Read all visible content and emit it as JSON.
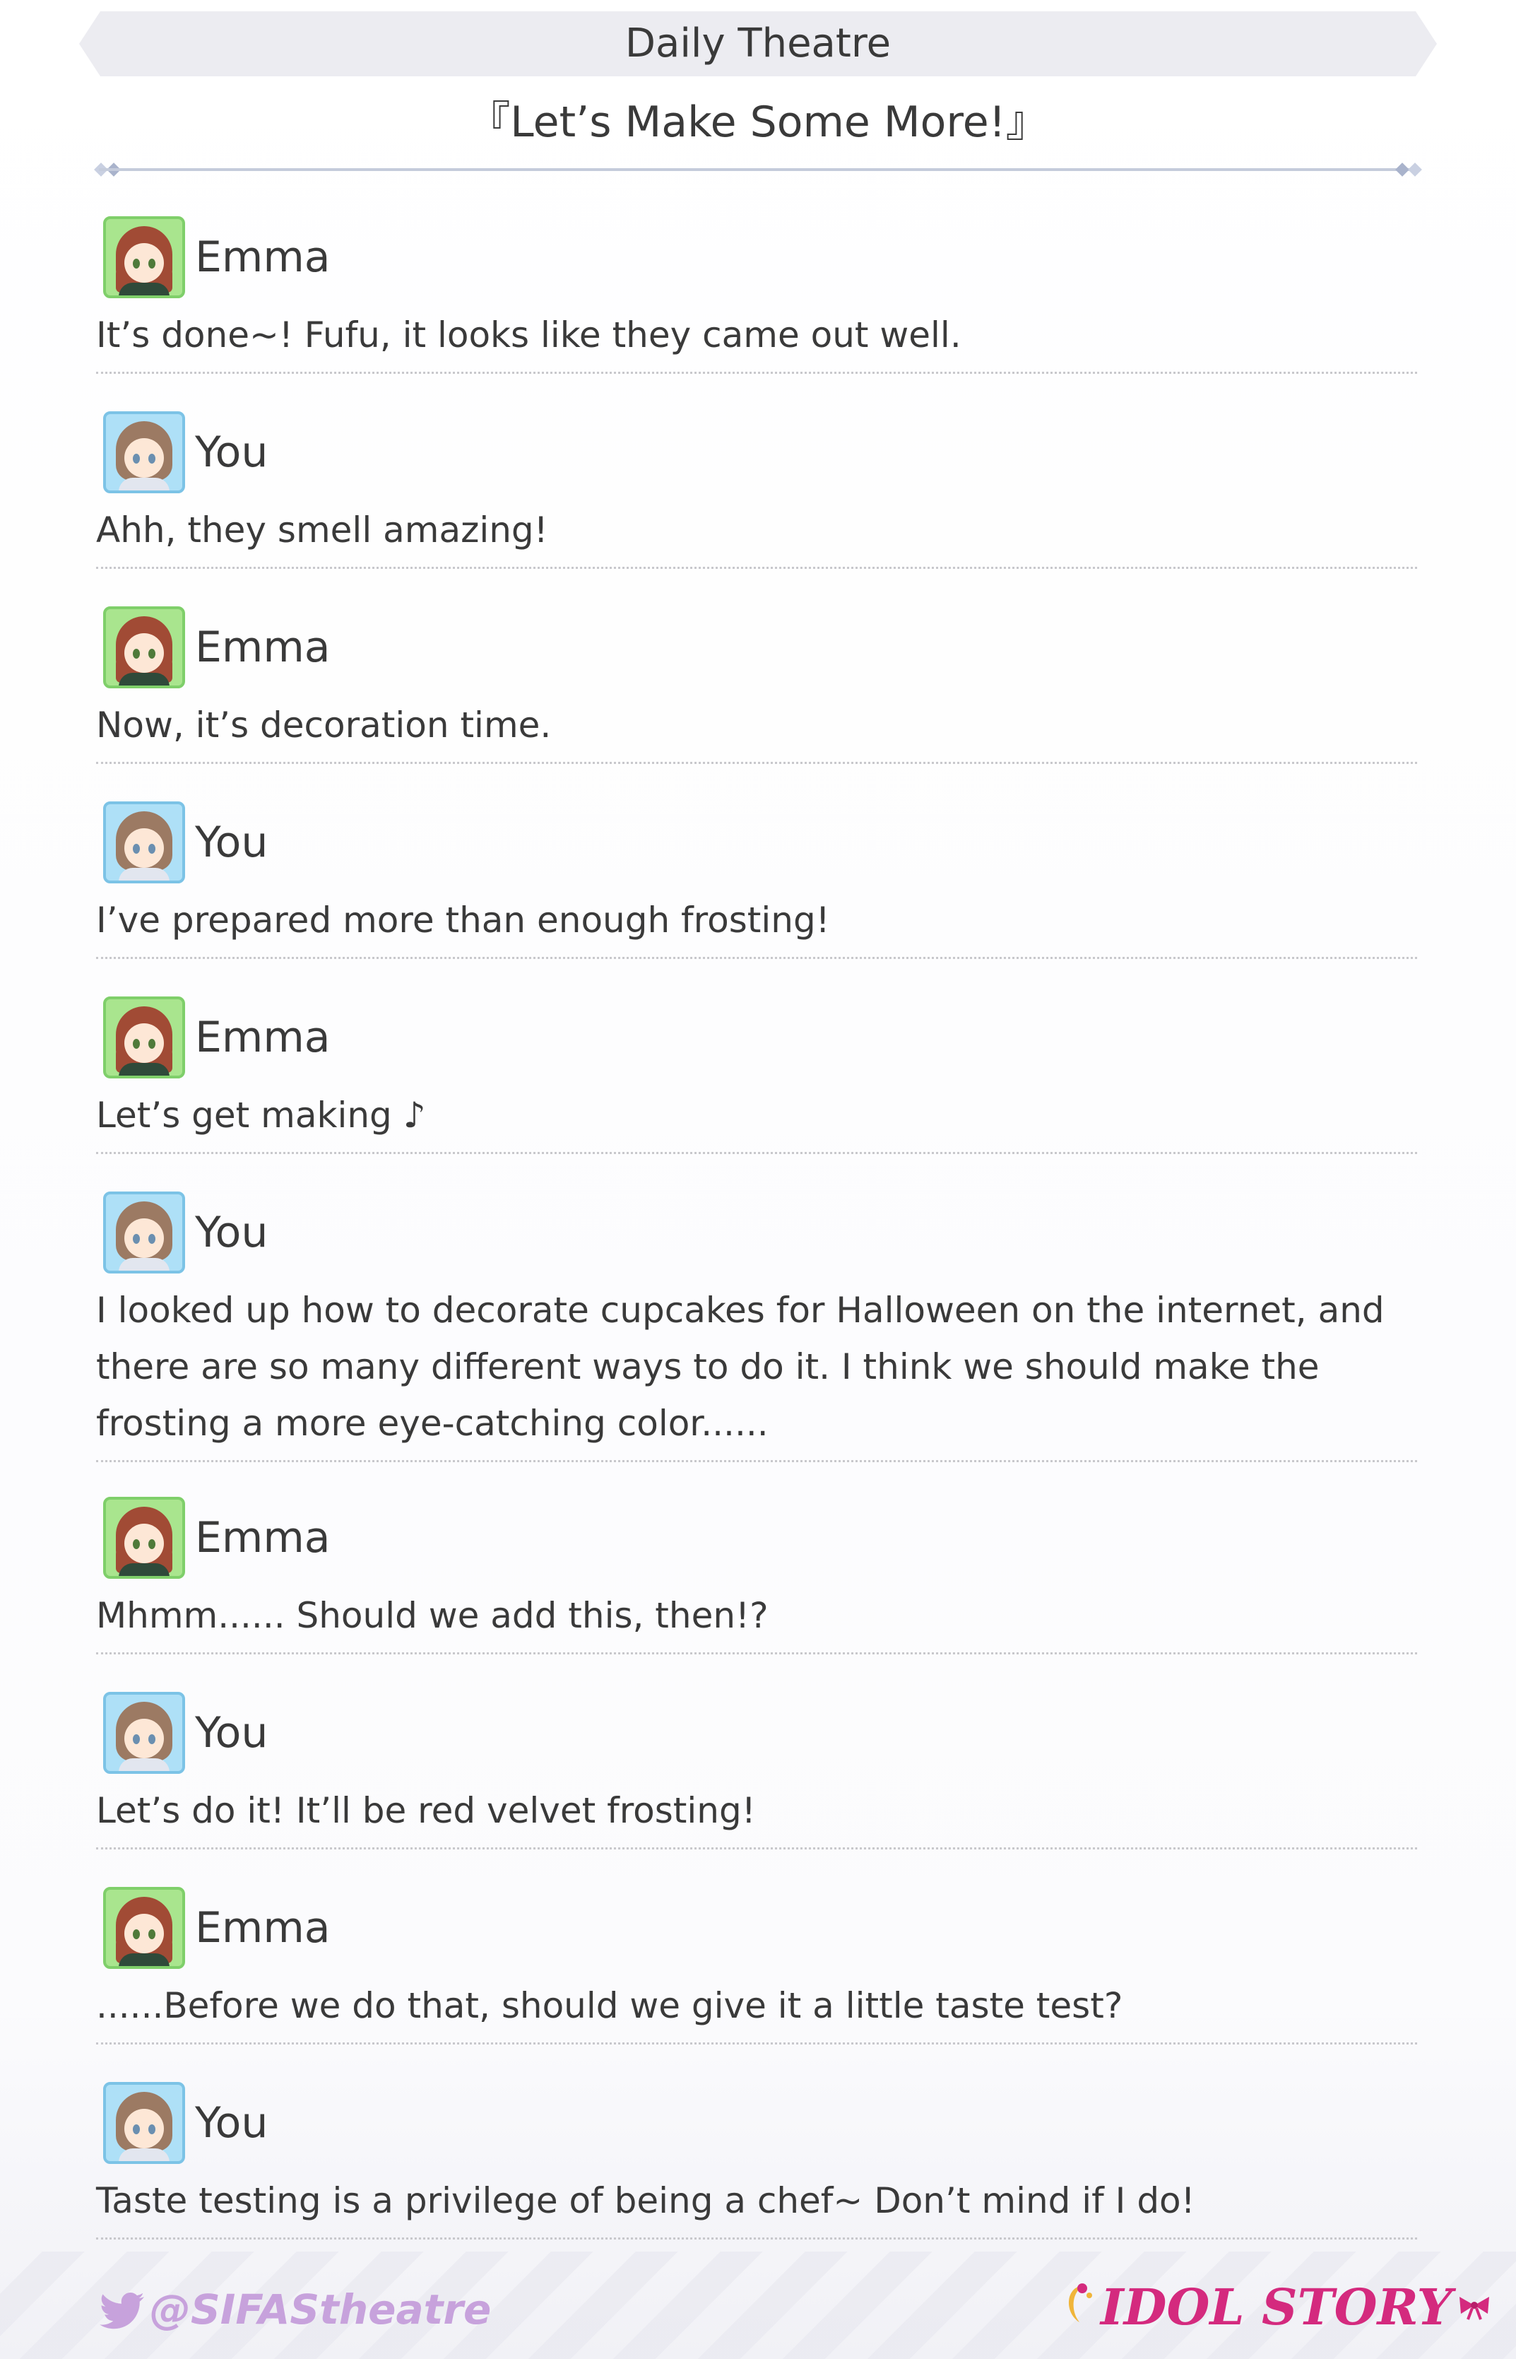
{
  "header": {
    "section": "Daily Theatre",
    "title": "『Let’s Make Some More!』"
  },
  "dialogue": [
    {
      "speaker": "Emma",
      "avatar": "emma-avatar-icon",
      "text": "It’s done~! Fufu, it looks like they came out well."
    },
    {
      "speaker": "You",
      "avatar": "you-avatar-icon",
      "text": "Ahh, they smell amazing!"
    },
    {
      "speaker": "Emma",
      "avatar": "emma-avatar-icon",
      "text": "Now, it’s decoration time."
    },
    {
      "speaker": "You",
      "avatar": "you-avatar-icon",
      "text": "I’ve prepared more than enough frosting!"
    },
    {
      "speaker": "Emma",
      "avatar": "emma-avatar-icon",
      "text": "Let’s get making ♪"
    },
    {
      "speaker": "You",
      "avatar": "you-avatar-icon",
      "text": "I looked up how to decorate cupcakes for Halloween on the internet, and there are so many different ways to do it. I think we should make the frosting a more eye-catching color......"
    },
    {
      "speaker": "Emma",
      "avatar": "emma-avatar-icon",
      "text": "Mhmm...... Should we add this, then!?"
    },
    {
      "speaker": "You",
      "avatar": "you-avatar-icon",
      "text": "Let’s do it! It’ll be red velvet frosting!"
    },
    {
      "speaker": "Emma",
      "avatar": "emma-avatar-icon",
      "text": "......Before we do that, should we give it a little taste test?"
    },
    {
      "speaker": "You",
      "avatar": "you-avatar-icon",
      "text": "Taste testing is a privilege of being a chef~ Don’t mind if I do!"
    }
  ],
  "footer": {
    "handle": "@SIFAStheatre",
    "handle_icon": "twitter-bird-icon",
    "logo_text": "IDOL STORY",
    "logo_icon": "idol-story-logo-icon"
  },
  "colors": {
    "emma_avatar_bg": "#a9e58e",
    "you_avatar_bg": "#aee0f7",
    "handle_color": "#c7a2dc",
    "logo_color": "#d42a7e",
    "divider": "#c4cbdb"
  }
}
